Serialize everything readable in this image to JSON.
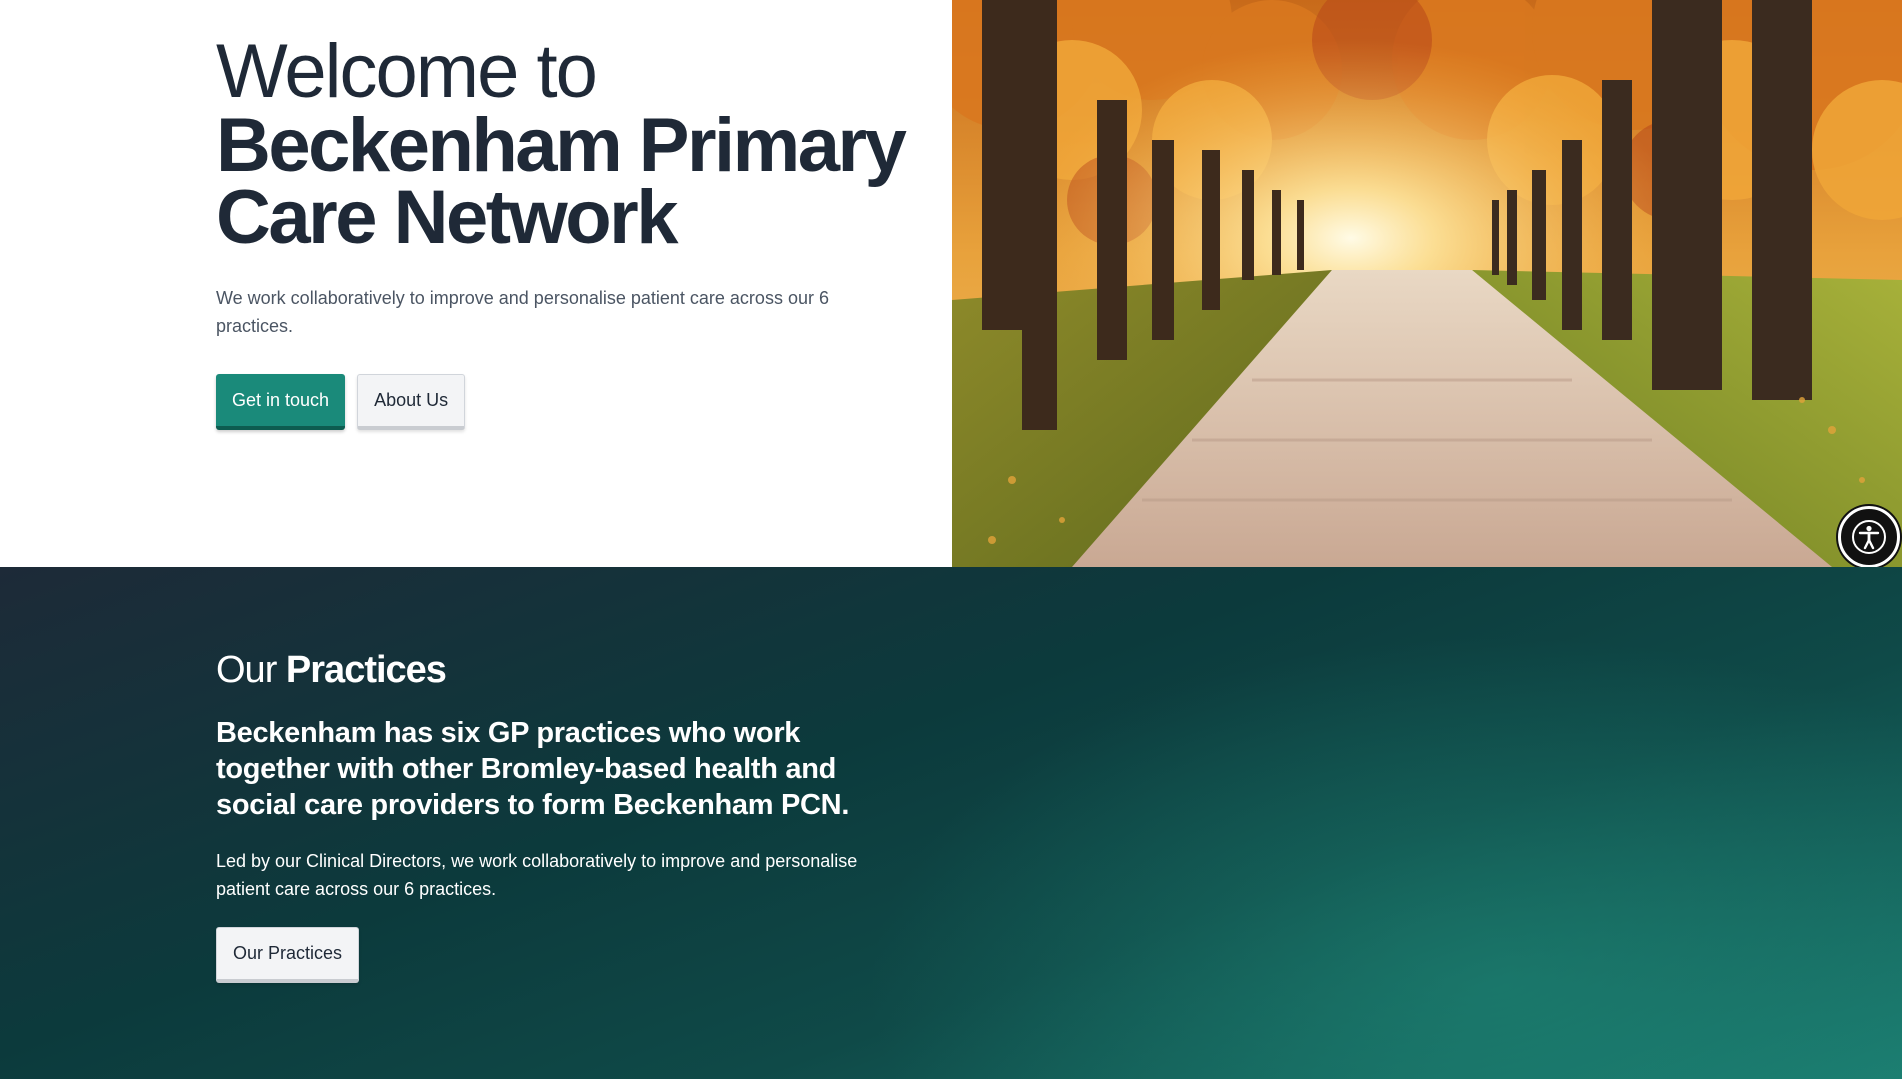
{
  "hero": {
    "title_line1": "Welcome to",
    "title_line2": "Beckenham Primary",
    "title_line3": "Care Network",
    "description": "We work collaboratively to improve and personalise patient care across our 6 practices.",
    "primary_button": "Get in touch",
    "secondary_button": "About Us",
    "image_icon": "autumn-tree-lined-path-image"
  },
  "accessibility": {
    "icon": "accessibility-person-icon"
  },
  "practices": {
    "heading_light": "Our",
    "heading_bold": "Practices",
    "lead": "Beckenham has six GP practices who work together with other Bromley-based health and social care providers to form Beckenham PCN.",
    "description": "Led by our Clinical Directors, we work collaboratively to improve and personalise patient care across our 6 practices.",
    "button": "Our Practices"
  },
  "colors": {
    "primary_teal": "#1a8a7a",
    "heading_dark": "#1f2937",
    "section_dark": "#1d2a38",
    "section_teal": "#1b7c70"
  }
}
